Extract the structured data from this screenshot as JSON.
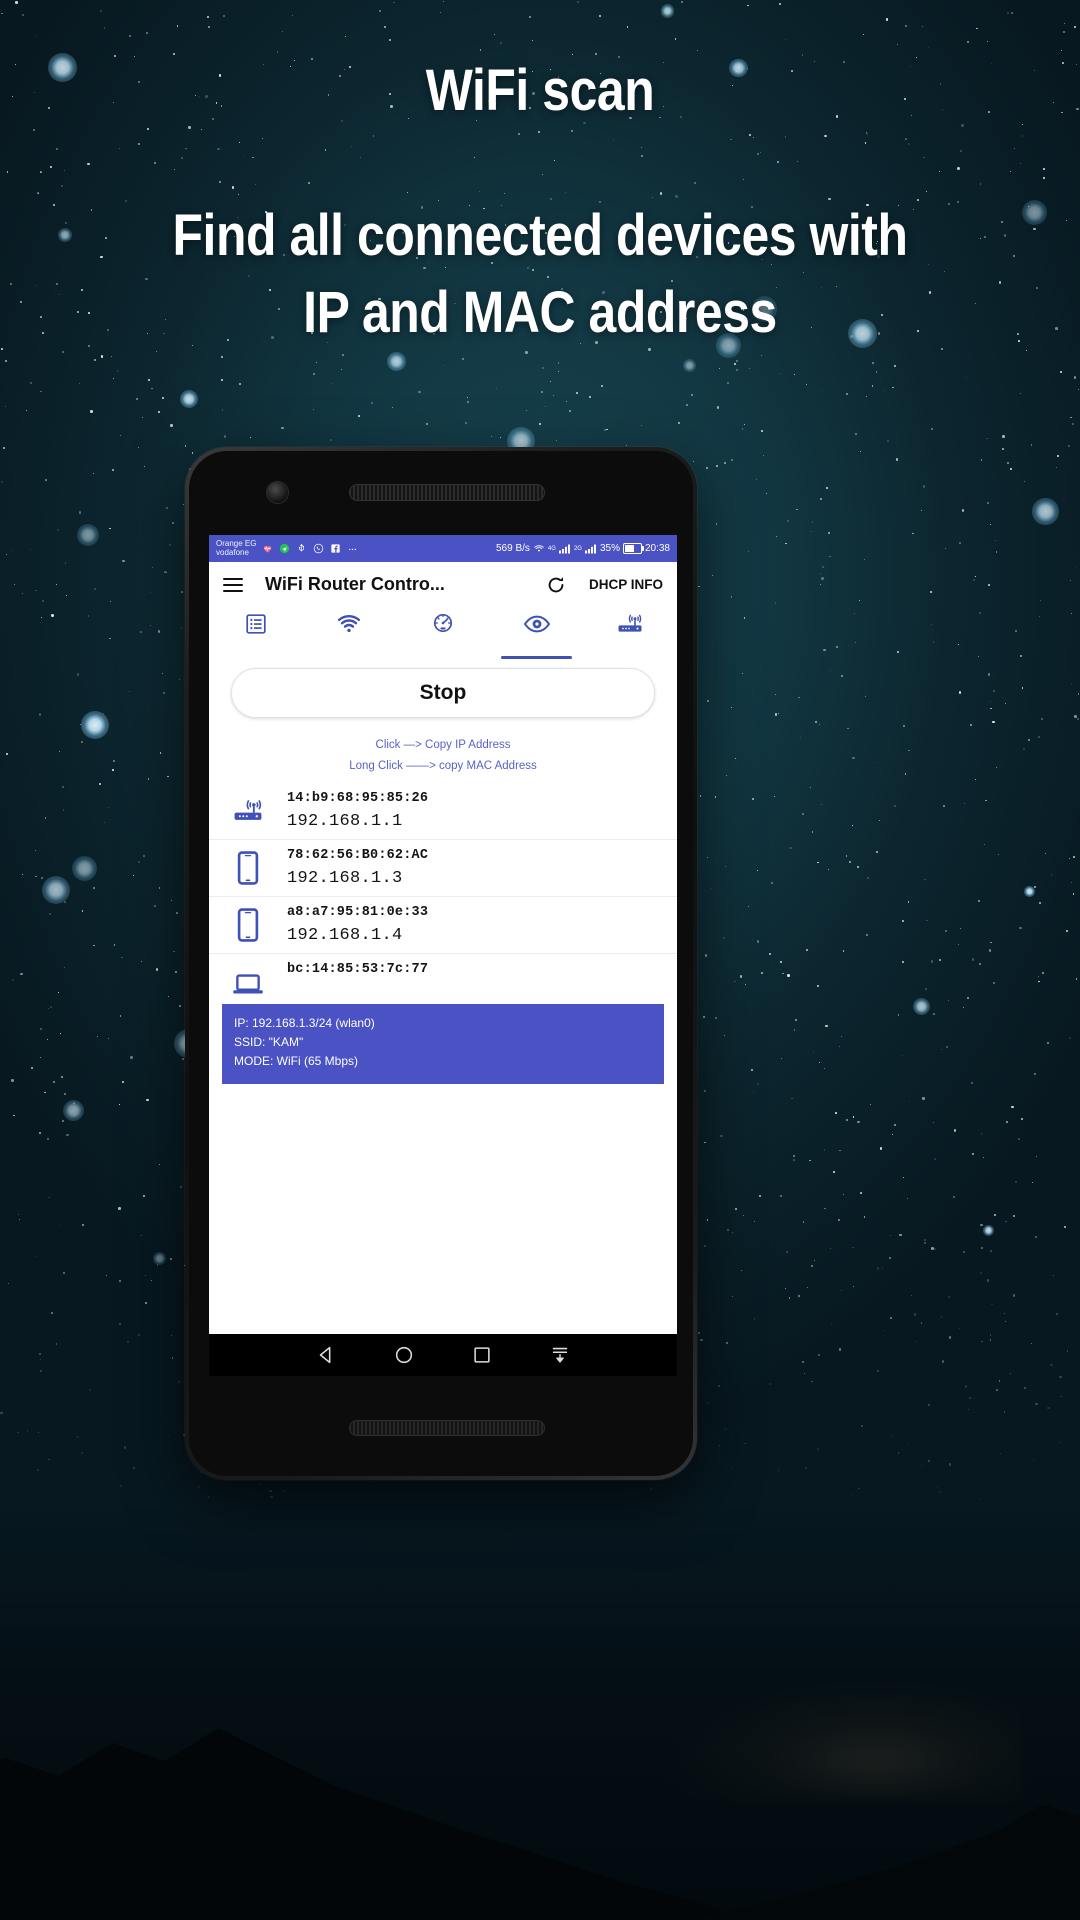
{
  "promo": {
    "title": "WiFi scan",
    "subtitle_line1": "Find all connected devices with",
    "subtitle_line2": "IP and MAC address"
  },
  "colors": {
    "accent": "#4a52c4",
    "tab_active": "#3f51b5",
    "link": "#5663c7",
    "screen_bg": "#ffffff"
  },
  "statusbar": {
    "carrier_line1": "Orange EG",
    "carrier_line2": "vodafone",
    "icons": [
      "heart-rate-icon",
      "location-icon",
      "usb-icon",
      "whatsapp-icon",
      "facebook-icon",
      "more-icon"
    ],
    "network_speed": "569 B/s",
    "wifi_icon": "wifi-icon",
    "sim1_label": "4G",
    "sim2_label": "2G",
    "battery_percent": "35%",
    "battery_icon": "battery-charging-icon",
    "time": "20:38"
  },
  "appbar": {
    "menu_icon": "hamburger-menu-icon",
    "title": "WiFi Router Contro...",
    "refresh_icon": "refresh-icon",
    "action_label": "DHCP INFO"
  },
  "tabs": [
    {
      "name": "tab-list",
      "icon": "list-icon",
      "active": false
    },
    {
      "name": "tab-wifi",
      "icon": "wifi-icon",
      "active": false
    },
    {
      "name": "tab-speed",
      "icon": "speedometer-icon",
      "active": false
    },
    {
      "name": "tab-scan",
      "icon": "eye-icon",
      "active": true
    },
    {
      "name": "tab-router",
      "icon": "router-icon",
      "active": false
    }
  ],
  "main": {
    "scan_button_label": "Stop",
    "hint_click": "Click —> Copy IP Address",
    "hint_long_click": "Long Click ——> copy MAC Address"
  },
  "devices": [
    {
      "icon": "router-icon",
      "mac": "14:b9:68:95:85:26",
      "ip": "192.168.1.1"
    },
    {
      "icon": "phone-icon",
      "mac": "78:62:56:B0:62:AC",
      "ip": "192.168.1.3"
    },
    {
      "icon": "phone-icon",
      "mac": "a8:a7:95:81:0e:33",
      "ip": "192.168.1.4"
    },
    {
      "icon": "laptop-icon",
      "mac": "bc:14:85:53:7c:77",
      "ip": ""
    }
  ],
  "infobox": {
    "ip_line": "IP: 192.168.1.3/24 (wlan0)",
    "ssid_line": "SSID: \"KAM\"",
    "mode_line": "MODE: WiFi (65 Mbps)"
  },
  "navbar": {
    "back": "back-triangle-icon",
    "home": "home-circle-icon",
    "recents": "recents-square-icon",
    "hide": "hide-navbar-icon"
  }
}
